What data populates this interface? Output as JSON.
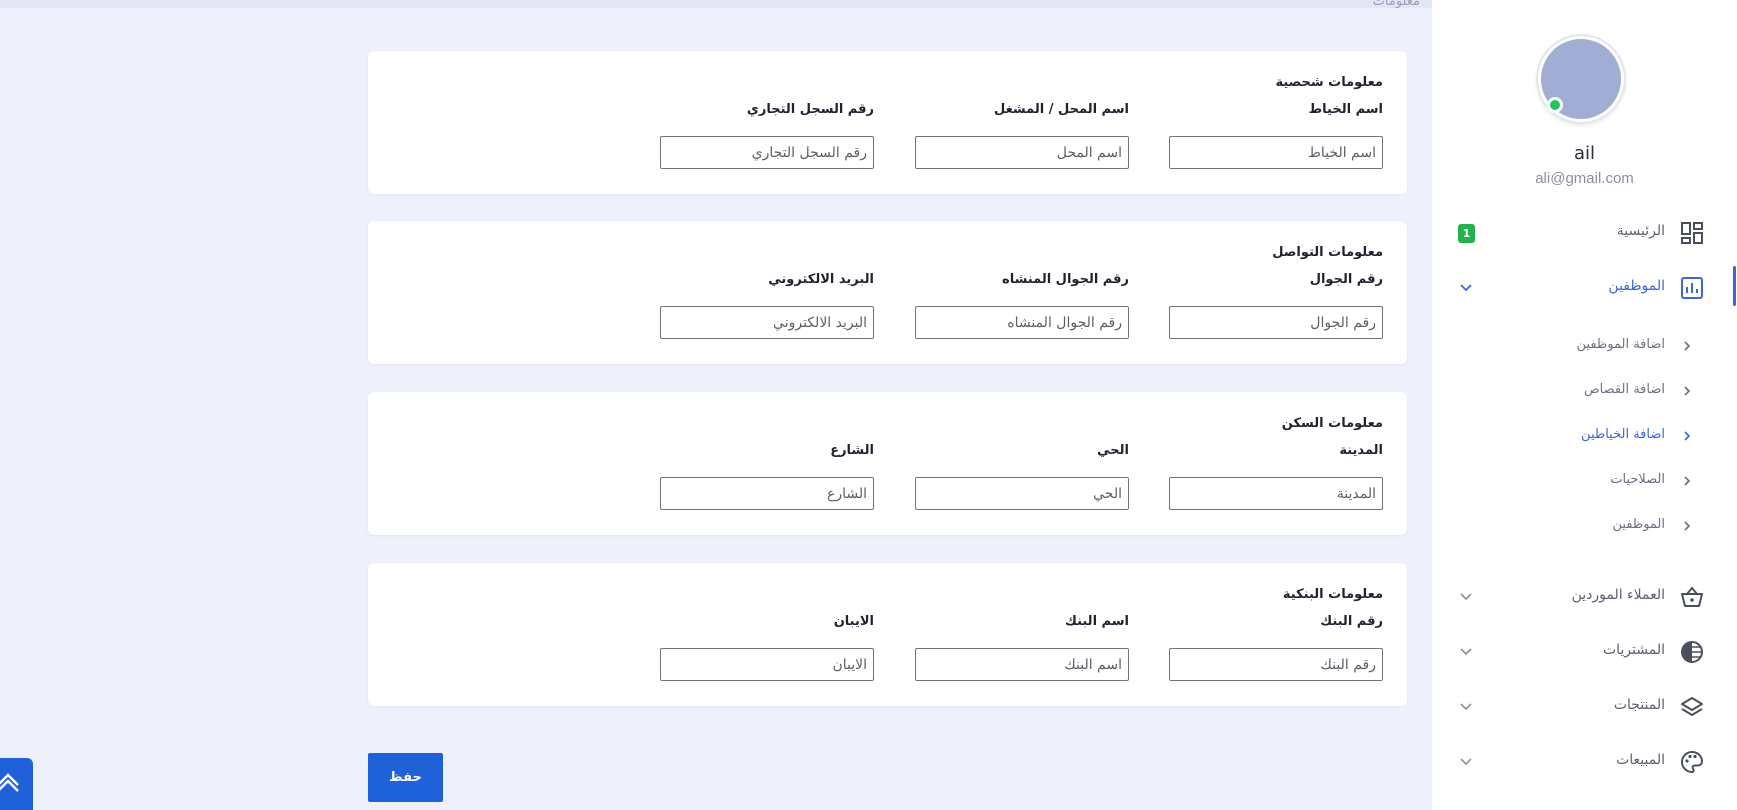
{
  "top_band": {
    "text": "معلومات"
  },
  "user": {
    "name": "ail",
    "email": "ali@gmail.com",
    "status": "online"
  },
  "sidebar": {
    "active_color": "#3b66d6",
    "items": [
      {
        "label": "الرئيسية",
        "icon": "dashboard-icon",
        "badge": "1",
        "active": false
      },
      {
        "label": "الموظفين",
        "icon": "bar-chart-icon",
        "active": true,
        "expanded": true
      },
      {
        "label": "العملاء الموردين",
        "icon": "basket-icon",
        "active": false
      },
      {
        "label": "المشتريات",
        "icon": "half-circle-icon",
        "active": false
      },
      {
        "label": "المنتجات",
        "icon": "layers-icon",
        "active": false
      },
      {
        "label": "المبيعات",
        "icon": "palette-icon",
        "active": false
      }
    ],
    "subitems": [
      {
        "label": "اضافة الموظفين",
        "active": false
      },
      {
        "label": "اضافة القصاص",
        "active": false
      },
      {
        "label": "اضافة الخياطين",
        "active": true
      },
      {
        "label": "الصلاحيات",
        "active": false
      },
      {
        "label": "الموظفين",
        "active": false
      }
    ]
  },
  "sections": [
    {
      "title": "معلومات شحصية",
      "fields": [
        {
          "label": "اسم الخياط",
          "placeholder": "اسم الخياط",
          "value": ""
        },
        {
          "label": "اسم المحل / المشغل",
          "placeholder": "اسم المحل",
          "value": ""
        },
        {
          "label": "رقم السجل التجاري",
          "placeholder": "رقم السجل التجاري",
          "value": ""
        }
      ]
    },
    {
      "title": "معلومات التواصل",
      "fields": [
        {
          "label": "رقم الجوال",
          "placeholder": "رقم الجوال",
          "value": ""
        },
        {
          "label": "رقم الجوال المنشاه",
          "placeholder": "رقم الجوال المنشاه",
          "value": ""
        },
        {
          "label": "البريد الالكتروني",
          "placeholder": "البريد الالكتروني",
          "value": ""
        }
      ]
    },
    {
      "title": "معلومات السكن",
      "fields": [
        {
          "label": "المدينة",
          "placeholder": "المدينة",
          "value": ""
        },
        {
          "label": "الحي",
          "placeholder": "الحي",
          "value": ""
        },
        {
          "label": "الشارع",
          "placeholder": "الشارع",
          "value": ""
        }
      ]
    },
    {
      "title": "معلومات البنكية",
      "fields": [
        {
          "label": "رقم البنك",
          "placeholder": "رقم البنك",
          "value": ""
        },
        {
          "label": "اسم البنك",
          "placeholder": "اسم البنك",
          "value": ""
        },
        {
          "label": "الايبان",
          "placeholder": "الايبان",
          "value": ""
        }
      ]
    }
  ],
  "actions": {
    "save_label": "حفظ",
    "primary_color": "#1f61d8",
    "scroll_top_icon": "double-chevron-up-icon"
  }
}
